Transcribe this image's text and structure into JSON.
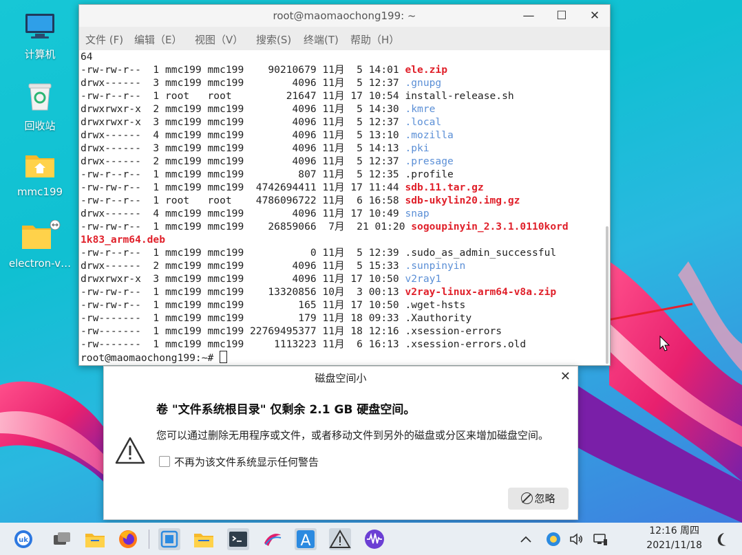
{
  "desktop": {
    "icons": [
      {
        "label": "计算机",
        "icon": "computer-icon"
      },
      {
        "label": "回收站",
        "icon": "trash-icon"
      },
      {
        "label": "mmc199",
        "icon": "home-folder-icon"
      },
      {
        "label": "electron-v…",
        "icon": "folder-icon"
      }
    ]
  },
  "terminal": {
    "title": "root@maomaochong199: ~",
    "menu": [
      "文件 (F)",
      "编辑（E）",
      "视图（V）",
      "搜索(S)",
      "终端(T)",
      "帮助（H）"
    ],
    "lines": [
      {
        "text": "64",
        "name": "",
        "cls": "blue"
      },
      {
        "text": "-rw-rw-r--  1 mmc199 mmc199    90210679 11月  5 14:01 ",
        "name": "ele.zip",
        "cls": "red"
      },
      {
        "text": "drwx------  3 mmc199 mmc199        4096 11月  5 12:37 ",
        "name": ".gnupg",
        "cls": "blue"
      },
      {
        "text": "-rw-r--r--  1 root   root         21647 11月 17 10:54 ",
        "name": "install-release.sh",
        "cls": ""
      },
      {
        "text": "drwxrwxr-x  2 mmc199 mmc199        4096 11月  5 14:30 ",
        "name": ".kmre",
        "cls": "blue"
      },
      {
        "text": "drwxrwxr-x  3 mmc199 mmc199        4096 11月  5 12:37 ",
        "name": ".local",
        "cls": "blue"
      },
      {
        "text": "drwx------  4 mmc199 mmc199        4096 11月  5 13:10 ",
        "name": ".mozilla",
        "cls": "blue"
      },
      {
        "text": "drwx------  3 mmc199 mmc199        4096 11月  5 14:13 ",
        "name": ".pki",
        "cls": "blue"
      },
      {
        "text": "drwx------  2 mmc199 mmc199        4096 11月  5 12:37 ",
        "name": ".presage",
        "cls": "blue"
      },
      {
        "text": "-rw-r--r--  1 mmc199 mmc199         807 11月  5 12:35 ",
        "name": ".profile",
        "cls": ""
      },
      {
        "text": "-rw-rw-r--  1 mmc199 mmc199  4742694411 11月 17 11:44 ",
        "name": "sdb.11.tar.gz",
        "cls": "red"
      },
      {
        "text": "-rw-r--r--  1 root   root    4786096722 11月  6 16:58 ",
        "name": "sdb-ukylin20.img.gz",
        "cls": "red"
      },
      {
        "text": "drwx------  4 mmc199 mmc199        4096 11月 17 10:49 ",
        "name": "snap",
        "cls": "blue"
      },
      {
        "text": "-rw-rw-r--  1 mmc199 mmc199    26859066  7月  21 01:20 ",
        "name": "sogoupinyin_2.3.1.0110kord",
        "cls": "red"
      },
      {
        "text": "",
        "name": "1k83_arm64.deb",
        "cls": "red"
      },
      {
        "text": "-rw-r--r--  1 mmc199 mmc199           0 11月  5 12:39 ",
        "name": ".sudo_as_admin_successful",
        "cls": ""
      },
      {
        "text": "drwx------  2 mmc199 mmc199        4096 11月  5 15:33 ",
        "name": ".sunpinyin",
        "cls": "blue"
      },
      {
        "text": "drwxrwxr-x  3 mmc199 mmc199        4096 11月 17 10:50 ",
        "name": "v2ray1",
        "cls": "blue"
      },
      {
        "text": "-rw-rw-r--  1 mmc199 mmc199    13320856 10月  3 00:13 ",
        "name": "v2ray-linux-arm64-v8a.zip",
        "cls": "red"
      },
      {
        "text": "-rw-rw-r--  1 mmc199 mmc199         165 11月 17 10:50 ",
        "name": ".wget-hsts",
        "cls": ""
      },
      {
        "text": "-rw-------  1 mmc199 mmc199         179 11月 18 09:33 ",
        "name": ".Xauthority",
        "cls": ""
      },
      {
        "text": "-rw-------  1 mmc199 mmc199 22769495377 11月 18 12:16 ",
        "name": ".xsession-errors",
        "cls": ""
      },
      {
        "text": "-rw-------  1 mmc199 mmc199     1113223 11月  6 16:13 ",
        "name": ".xsession-errors.old",
        "cls": ""
      }
    ],
    "prompt": "root@maomaochong199:~# "
  },
  "dialog": {
    "title": "磁盘空间小",
    "heading": "卷 \"文件系统根目录\" 仅剩余 2.1 GB 硬盘空间。",
    "message": "您可以通过删除无用程序或文件，或者移动文件到另外的磁盘或分区来增加磁盘空间。",
    "checkbox_label": "不再为该文件系统显示任何警告",
    "ignore_label": "忽略"
  },
  "taskbar": {
    "time": "12:16 周四",
    "date": "2021/11/18"
  }
}
